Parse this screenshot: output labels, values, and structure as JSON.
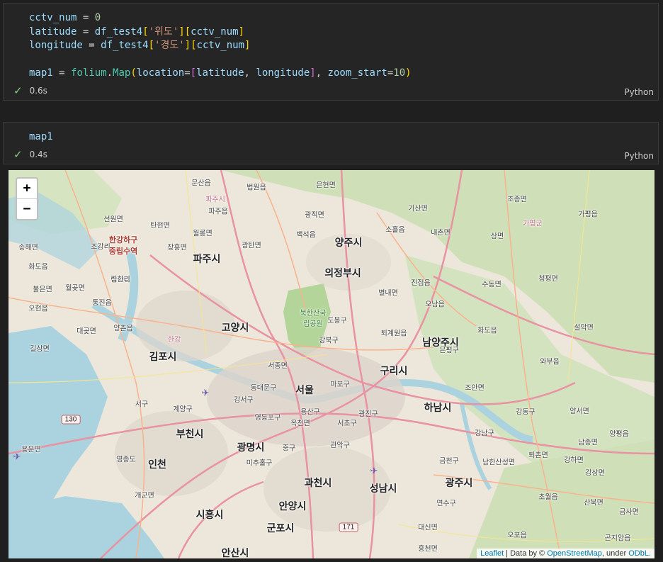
{
  "cells": [
    {
      "code_lines": [
        "cctv_num = 0",
        "latitude = df_test4['위도'][cctv_num]",
        "longitude = df_test4['경도'][cctv_num]",
        "",
        "map1 = folium.Map(location=[latitude, longitude], zoom_start=10)"
      ],
      "exec_time": "0.6s",
      "language": "Python"
    },
    {
      "code_lines": [
        "map1"
      ],
      "exec_time": "0.4s",
      "language": "Python"
    }
  ],
  "map": {
    "zoom_in": "+",
    "zoom_out": "−",
    "attribution": {
      "leaflet": "Leaflet",
      "sep": " | Data by © ",
      "osm": "OpenStreetMap",
      "under": ", under ",
      "odbl": "ODbL."
    },
    "labels_city": [
      "파주시",
      "양주시",
      "의정부시",
      "고양시",
      "김포시",
      "남양주시",
      "구리시",
      "서울",
      "하남시",
      "부천시",
      "광명시",
      "인천",
      "과천시",
      "성남시",
      "광주시",
      "시흥시",
      "안양시",
      "군포시",
      "안산시"
    ],
    "labels_town": [
      "문산읍",
      "법원읍",
      "은현면",
      "파주읍",
      "광적면",
      "가산면",
      "조종면",
      "가평읍",
      "탄현면",
      "월롱면",
      "백석읍",
      "소흘읍",
      "내촌면",
      "상면",
      "광탄면",
      "송해면",
      "조강리",
      "화도읍",
      "하성면",
      "장흥면",
      "별내면",
      "진접읍",
      "수동면",
      "청평면",
      "월곶면",
      "통진읍",
      "도봉구",
      "오남읍",
      "화도읍",
      "설악면",
      "대곶면",
      "양촌읍",
      "강북구",
      "퇴계원읍",
      "길상면",
      "은평구",
      "와부읍",
      "서종면",
      "마포구",
      "동대문구",
      "조안면",
      "서구",
      "강서구",
      "계양구",
      "영등포구",
      "용산구",
      "광진구",
      "강동구",
      "양서면",
      "옥천면",
      "중구",
      "관악구",
      "서초구",
      "강남구",
      "남종면",
      "양평읍",
      "용문면",
      "영종도",
      "미추홀구",
      "금천구",
      "남한산성면",
      "퇴촌면",
      "강하면",
      "강상면",
      "개군면",
      "연수구",
      "초월읍",
      "산북면",
      "금사면",
      "대신면",
      "오포읍",
      "곤지암읍",
      "흥천면",
      "오현읍",
      "불은면",
      "선원면",
      "림한리",
      "하성면"
    ],
    "label_red": "한강하구\n중립수역",
    "label_park": "북한산국\n립공원",
    "label_pink": [
      "파주시",
      "가평군",
      "한강"
    ],
    "shields": [
      "130",
      "171"
    ]
  }
}
